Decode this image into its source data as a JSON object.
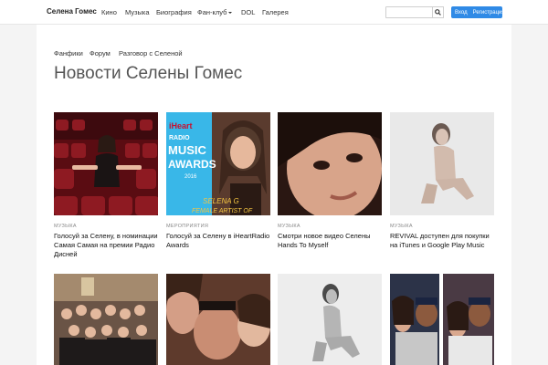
{
  "nav": {
    "brand": "Селена Гомес",
    "items": [
      "Кино",
      "Музыка",
      "Биография",
      "Фан-клуб",
      "DOL",
      "Галерея"
    ],
    "login": "Вход",
    "register": "Регистрация"
  },
  "subnav": [
    "Фанфики",
    "Форум",
    "Разговор с Селеной"
  ],
  "title": "Новости Селены Гомес",
  "cards": [
    {
      "category": "МУЗЫКА",
      "title": "Голосуй за Селену, в номинации Самая Самая на премии Радио Дисней"
    },
    {
      "category": "МЕРОПРИЯТИЯ",
      "title": "Голосуй за Селену в iHeartRadio Awards",
      "image_text": [
        "iHeart",
        "RADIO",
        "MUSIC",
        "AWARDS",
        "2016",
        "SELENA G",
        "FEMALE ARTIST OF"
      ]
    },
    {
      "category": "МУЗЫКА",
      "title": "Смотри новое видео Селены Hands To Myself"
    },
    {
      "category": "МУЗЫКА",
      "title": "REVIVAL доступен для покупки на iTunes и Google Play Music"
    }
  ]
}
